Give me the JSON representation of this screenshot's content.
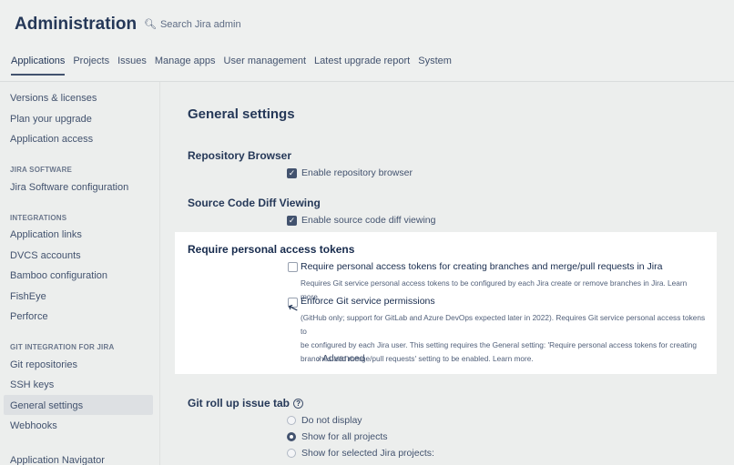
{
  "header": {
    "title": "Administration",
    "search_placeholder": "Search Jira admin",
    "tabs": [
      {
        "label": "Applications",
        "active": true
      },
      {
        "label": "Projects"
      },
      {
        "label": "Issues"
      },
      {
        "label": "Manage apps"
      },
      {
        "label": "User management"
      },
      {
        "label": "Latest upgrade report"
      },
      {
        "label": "System"
      }
    ]
  },
  "sidebar": {
    "items": [
      {
        "label": "Versions & licenses"
      },
      {
        "label": "Plan your upgrade"
      },
      {
        "label": "Application access"
      }
    ],
    "jira_software": {
      "heading": "JIRA SOFTWARE",
      "items": [
        {
          "label": "Jira Software configuration"
        }
      ]
    },
    "integrations": {
      "heading": "INTEGRATIONS",
      "items": [
        {
          "label": "Application links"
        },
        {
          "label": "DVCS accounts"
        },
        {
          "label": "Bamboo configuration"
        },
        {
          "label": "FishEye"
        },
        {
          "label": "Perforce"
        }
      ]
    },
    "git_integration": {
      "heading": "GIT INTEGRATION FOR JIRA",
      "items": [
        {
          "label": "Git repositories"
        },
        {
          "label": "SSH keys"
        },
        {
          "label": "General settings",
          "active": true
        },
        {
          "label": "Webhooks"
        }
      ]
    },
    "footer_item": "Application Navigator"
  },
  "main": {
    "title": "General settings",
    "repo_browser": {
      "title": "Repository Browser",
      "option": "Enable repository browser",
      "checked": true
    },
    "diff_viewing": {
      "title": "Source Code Diff Viewing",
      "option": "Enable source code diff viewing",
      "checked": true
    },
    "tokens": {
      "title": "Require personal access tokens",
      "opt1_label": "Require personal access tokens for creating branches and merge/pull requests in Jira",
      "opt1_desc": "Requires Git service personal access tokens to be configured by each Jira create or remove branches in Jira. Learn more.",
      "opt2_label": "Enforce Git service permissions",
      "opt2_desc_lines": [
        "(GitHub only; support for GitLab and Azure DevOps expected later in 2022). Requires Git service personal access tokens to",
        "be configured by each Jira user. This setting requires the General setting: 'Require personal access tokens for creating",
        "branches and merge/pull requests' setting to be enabled. Learn more."
      ],
      "advanced_label": "Advanced"
    },
    "rollup": {
      "title": "Git roll up issue tab",
      "options": [
        {
          "label": "Do not display",
          "selected": false
        },
        {
          "label": "Show for all projects",
          "selected": true
        },
        {
          "label": "Show for selected Jira projects:",
          "selected": false
        }
      ]
    }
  }
}
